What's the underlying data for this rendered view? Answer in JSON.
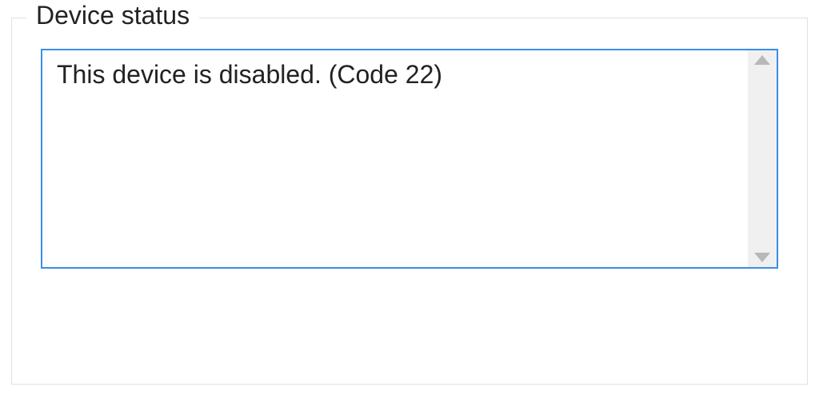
{
  "group": {
    "legend": "Device status"
  },
  "status": {
    "message": "This device is disabled. (Code 22)"
  }
}
